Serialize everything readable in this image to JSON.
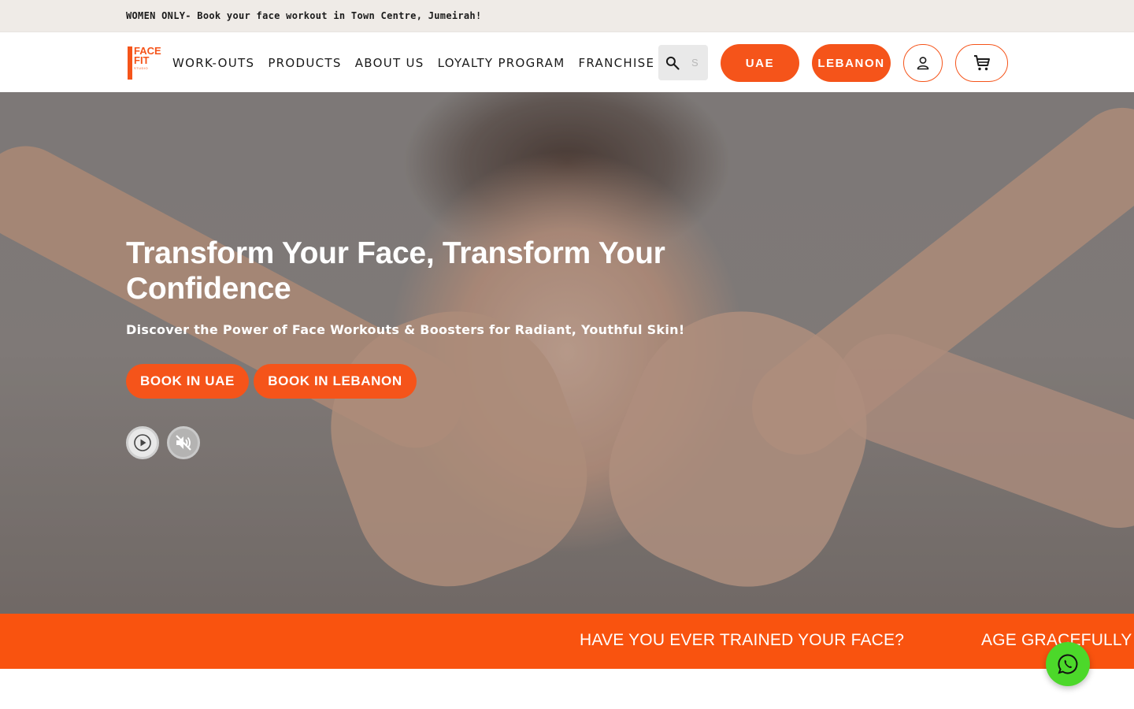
{
  "announcement": {
    "text": "WOMEN ONLY- Book your face workout in Town Centre, Jumeirah!"
  },
  "header": {
    "logo": {
      "line1": "FACE",
      "line2": "FIT",
      "line3": "STUDIO"
    },
    "nav": [
      {
        "label": "WORK-OUTS"
      },
      {
        "label": "PRODUCTS"
      },
      {
        "label": "ABOUT US"
      },
      {
        "label": "LOYALTY PROGRAM"
      },
      {
        "label": "FRANCHISE"
      }
    ],
    "search": {
      "placeholder": "S"
    },
    "region_buttons": [
      {
        "label": "UAE"
      },
      {
        "label": "LEBANON"
      }
    ],
    "icons": {
      "account": "account-icon",
      "cart": "cart-icon",
      "search": "search-icon"
    }
  },
  "hero": {
    "title": "Transform Your Face, Transform Your Confidence",
    "subtitle": "Discover the Power of Face Workouts & Boosters for Radiant, Youthful Skin!",
    "buttons": [
      {
        "label": "BOOK IN UAE"
      },
      {
        "label": "BOOK IN LEBANON"
      }
    ],
    "media_controls": {
      "play": "play-icon",
      "mute": "mute-icon"
    }
  },
  "marquee": {
    "items": [
      "HAVE YOU EVER TRAINED YOUR FACE?",
      "AGE GRACEFULLY"
    ]
  },
  "whatsapp": {
    "icon": "whatsapp-icon"
  },
  "colors": {
    "accent": "#f5541a",
    "announcement_bg": "#efebe7",
    "whatsapp": "#4cd82a"
  }
}
